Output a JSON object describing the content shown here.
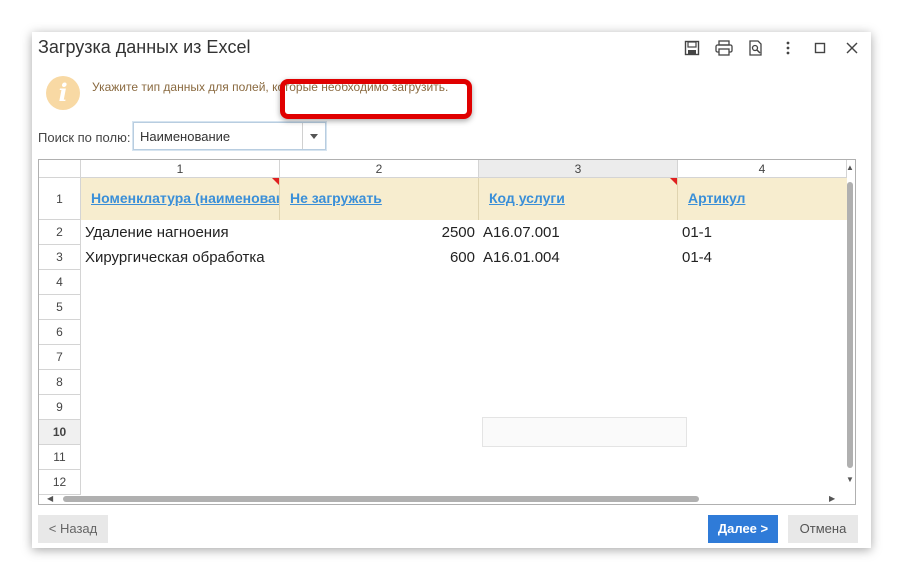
{
  "window": {
    "title": "Загрузка данных из Excel",
    "toolbar_icons": [
      "save-icon",
      "print-icon",
      "preview-icon",
      "more-icon",
      "maximize-icon",
      "close-icon"
    ]
  },
  "info": {
    "icon_glyph": "i",
    "text": "Укажите тип данных для полей, которые необходимо загрузить."
  },
  "search": {
    "label": "Поиск по полю:",
    "value": "Наименование"
  },
  "grid": {
    "column_numbers": [
      "1",
      "2",
      "3",
      "4"
    ],
    "selected_column": "3",
    "header_row_number": "1",
    "headers": [
      "Номенклатура (наименование)",
      "Не загружать",
      "Код услуги",
      "Артикул"
    ],
    "rows": [
      {
        "num": "2",
        "cells": [
          "Удаление нагноения",
          "2500",
          "A16.07.001",
          "01-1"
        ]
      },
      {
        "num": "3",
        "cells": [
          "Хирургическая обработка",
          "600",
          "A16.01.004",
          "01-4"
        ]
      }
    ],
    "empty_row_numbers": [
      "4",
      "5",
      "6",
      "7",
      "8",
      "9",
      "10",
      "11",
      "12"
    ],
    "selected_row": "10"
  },
  "buttons": {
    "back": "< Назад",
    "next": "Далее >",
    "cancel": "Отмена"
  },
  "colors": {
    "accent": "#2f7bd8",
    "link": "#3a8fd8",
    "header_bg": "#f7edcf",
    "highlight": "#e00000"
  }
}
